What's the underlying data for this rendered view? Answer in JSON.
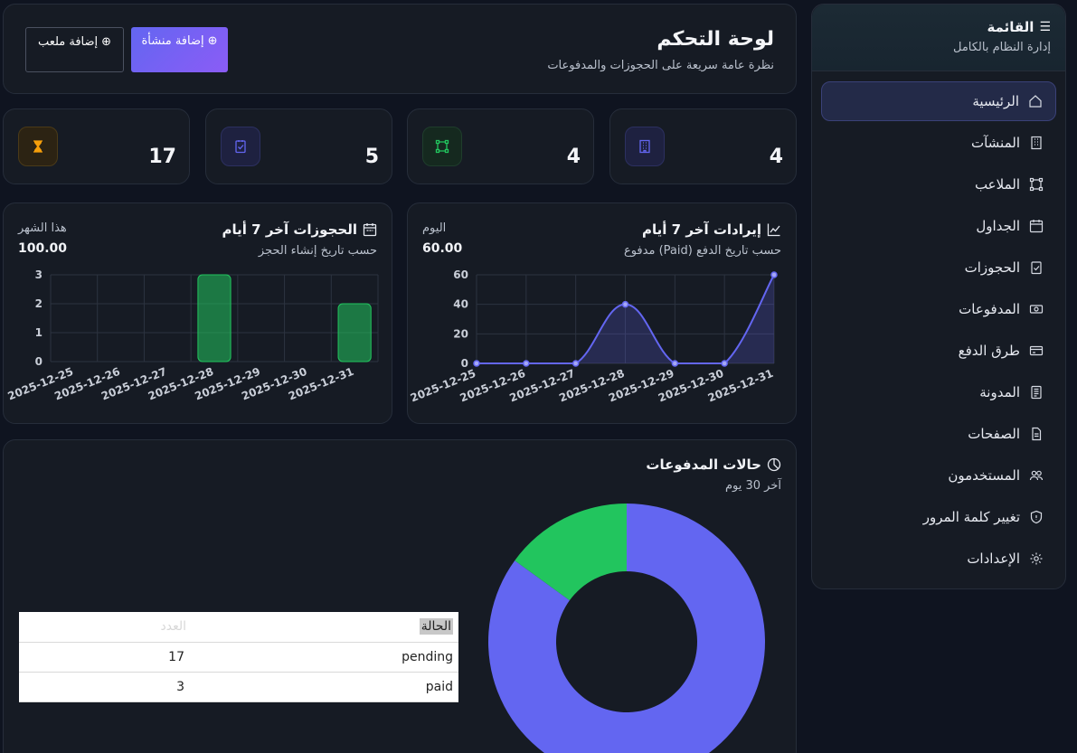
{
  "sidebar": {
    "title": "القائمة",
    "subtitle": "إدارة النظام بالكامل",
    "items": [
      {
        "label": "الرئيسية",
        "icon": "home-icon"
      },
      {
        "label": "المنشآت",
        "icon": "building-icon"
      },
      {
        "label": "الملاعب",
        "icon": "field-icon"
      },
      {
        "label": "الجداول",
        "icon": "calendar-icon"
      },
      {
        "label": "الحجوزات",
        "icon": "booking-icon"
      },
      {
        "label": "المدفوعات",
        "icon": "cash-icon"
      },
      {
        "label": "طرق الدفع",
        "icon": "card-icon"
      },
      {
        "label": "المدونة",
        "icon": "blog-icon"
      },
      {
        "label": "الصفحات",
        "icon": "page-icon"
      },
      {
        "label": "المستخدمون",
        "icon": "users-icon"
      },
      {
        "label": "تغيير كلمة المرور",
        "icon": "shield-icon"
      },
      {
        "label": "الإعدادات",
        "icon": "gear-icon"
      }
    ]
  },
  "header": {
    "title": "لوحة التحكم",
    "subtitle": "نظرة عامة سريعة على الحجوزات والمدفوعات",
    "add_facility": "إضافة منشأة",
    "add_field": "إضافة ملعب"
  },
  "stats": [
    {
      "value": "4",
      "icon": "building-icon",
      "color": "#6366f1"
    },
    {
      "value": "4",
      "icon": "field-icon",
      "color": "#22c55e"
    },
    {
      "value": "5",
      "icon": "booking-icon",
      "color": "#6366f1"
    },
    {
      "value": "17",
      "icon": "hourglass-icon",
      "color": "#f59e0b"
    }
  ],
  "revenue": {
    "title": "إيرادات آخر 7 أيام",
    "subtitle": "مدفوع (Paid) حسب تاريخ الدفع",
    "kpi_label": "اليوم",
    "kpi_value": "60.00"
  },
  "bookings": {
    "title": "الحجوزات آخر 7 أيام",
    "subtitle": "حسب تاريخ إنشاء الحجز",
    "kpi_label": "هذا الشهر",
    "kpi_value": "100.00"
  },
  "payments": {
    "title": "حالات المدفوعات",
    "subtitle": "آخر 30 يوم",
    "table_headers": {
      "status": "الحالة",
      "count": "العدد"
    },
    "rows": [
      {
        "status": "pending",
        "count": "17"
      },
      {
        "status": "paid",
        "count": "3"
      }
    ]
  },
  "chart_data": [
    {
      "type": "area",
      "categories": [
        "2025-12-25",
        "2025-12-26",
        "2025-12-27",
        "2025-12-28",
        "2025-12-29",
        "2025-12-30",
        "2025-12-31"
      ],
      "values": [
        0,
        0,
        0,
        40,
        0,
        0,
        60
      ],
      "ylim": [
        0,
        60
      ],
      "yticks": [
        0,
        20,
        40,
        60
      ],
      "color": "#6366f1",
      "grid": true
    },
    {
      "type": "bar",
      "categories": [
        "2025-12-25",
        "2025-12-26",
        "2025-12-27",
        "2025-12-28",
        "2025-12-29",
        "2025-12-30",
        "2025-12-31"
      ],
      "values": [
        0,
        0,
        0,
        3,
        0,
        0,
        2
      ],
      "ylim": [
        0,
        3
      ],
      "yticks": [
        0,
        1,
        2,
        3
      ],
      "color": "#22c55e",
      "grid": true
    },
    {
      "type": "pie",
      "categories": [
        "pending",
        "paid"
      ],
      "values": [
        17,
        3
      ],
      "colors": [
        "#6366f1",
        "#22c55e"
      ]
    }
  ]
}
